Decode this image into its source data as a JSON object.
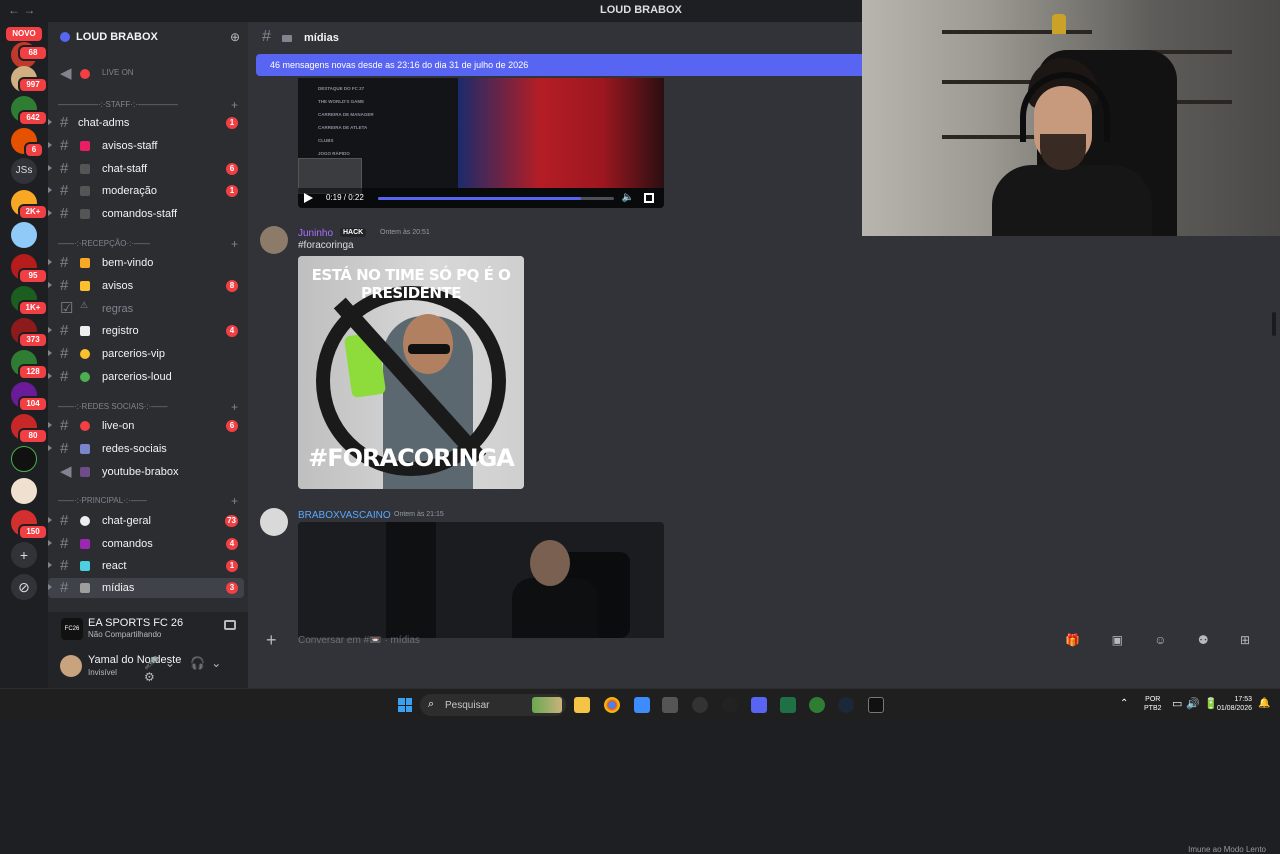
{
  "window": {
    "title": "LOUD BRABOX",
    "nav": "← →"
  },
  "rail": {
    "novo": "NOVO",
    "badges": [
      "68",
      "997",
      "642",
      "6",
      "2K+",
      "95",
      "1K+",
      "373",
      "128",
      "104",
      "80",
      "150"
    ],
    "text_server": "JSs",
    "add": "+",
    "explore": "⊘"
  },
  "server": {
    "name": "LOUD BRABOX",
    "chevron": "⌄"
  },
  "channels": {
    "live_on": "LIVE ON",
    "staff_cat": "—————·:·STAFF·:·—————",
    "chat_adms": {
      "label": "chat-adms",
      "count": "1"
    },
    "avisos_staff": {
      "label": "avisos-staff"
    },
    "chat_staff": {
      "label": "chat-staff",
      "count": "6"
    },
    "moderacao": {
      "label": "moderação",
      "count": "1"
    },
    "comandos_staff": {
      "label": "comandos-staff"
    },
    "recepcao_cat": "——·:·RECEPÇÃO·:·——",
    "bem_vindo": {
      "label": "bem-vindo"
    },
    "avisos": {
      "label": "avisos",
      "count": "8"
    },
    "regras": {
      "label": "regras"
    },
    "registro": {
      "label": "registro",
      "count": "4"
    },
    "parcerios_vip": {
      "label": "parcerios-vip"
    },
    "parcerios_loud": {
      "label": "parcerios-loud"
    },
    "redes_cat": "——·:·REDES SOCIAIS·:·——",
    "live_on_ch": {
      "label": "live-on",
      "count": "6"
    },
    "redes_sociais": {
      "label": "redes-sociais"
    },
    "youtube_brabox": {
      "label": "youtube-brabox"
    },
    "principal_cat": "——·:·PRINCIPAL·:·——",
    "chat_geral": {
      "label": "chat-geral",
      "count": "73"
    },
    "comandos": {
      "label": "comandos",
      "count": "4"
    },
    "react": {
      "label": "react",
      "count": "1"
    },
    "midias": {
      "label": "mídias",
      "count": "3"
    }
  },
  "activity": {
    "game": "EA SPORTS FC 26",
    "status": "Não Compartilhando",
    "logo": "FC26"
  },
  "user": {
    "name": "Yamal do Nordeste",
    "status": "Invisível",
    "controls": "🎤⌄ 🎧⌄ ⚙"
  },
  "channel_header": {
    "name": "mídias"
  },
  "new_messages": "46 mensagens novas desde as 23:16 do dia 31 de julho de 2026",
  "video1": {
    "menu": [
      "DESTAQUE DO FC 27",
      "THE WORLD'S GAME",
      "CARREIRA DE MANAGER",
      "CARREIRA DE ATLETA",
      "CLUBS",
      "JOGO RÁPIDO"
    ],
    "time": "0:19 / 0:22",
    "progress": 0.86
  },
  "message1": {
    "author": "Juninho",
    "tag": "HACK",
    "timestamp": "Ontem às 20:51",
    "text": "#foracoringa"
  },
  "image1": {
    "top_text": "ESTÁ NO TIME SÓ PQ É O PRESIDENTE",
    "bottom_text": "#FORACORINGA"
  },
  "message2": {
    "author": "BRABOXVASCAINO",
    "timestamp": "Ontem às 21:15"
  },
  "immune": "Imune ao Modo Lento",
  "composer": {
    "placeholder": "Conversar em #📼 · mídias",
    "tools": "🎁 ▣ ☺ ⚉ ⊞"
  },
  "taskbar": {
    "search": "Pesquisar",
    "lang": "POR\nPTB2",
    "time": "17:53",
    "date": "01/08/2026"
  },
  "colors": {
    "accent": "#5865f2",
    "badge": "#f23f43"
  }
}
